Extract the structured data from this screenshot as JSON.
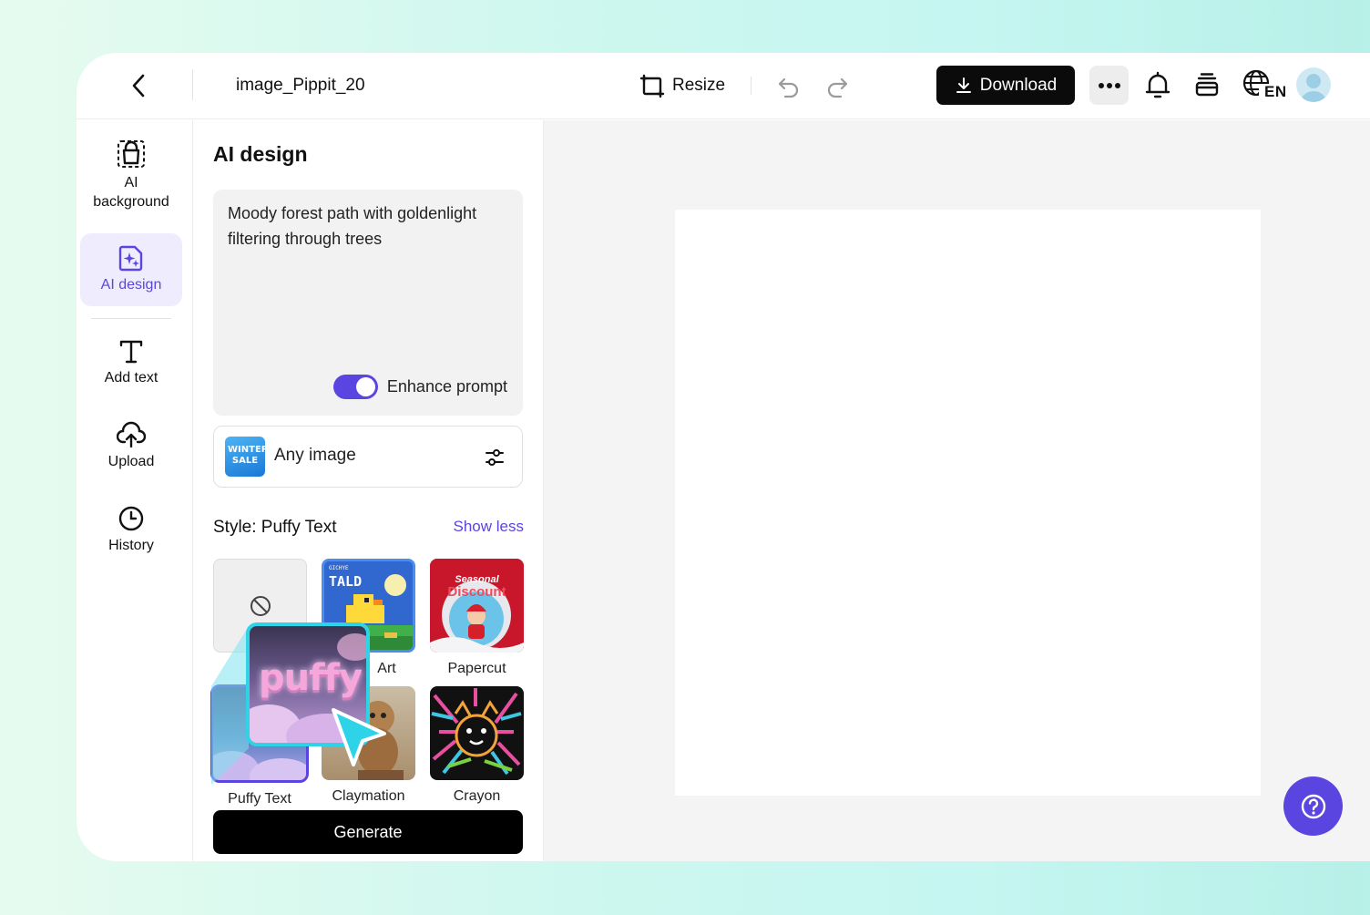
{
  "header": {
    "file_name": "image_Pippit_20",
    "resize_label": "Resize",
    "download_label": "Download",
    "language": "EN"
  },
  "nav": {
    "items": [
      {
        "label": "AI background",
        "icon": "ai-background-icon"
      },
      {
        "label": "AI design",
        "icon": "ai-design-icon",
        "active": true
      },
      {
        "label": "Add text",
        "icon": "text-icon"
      },
      {
        "label": "Upload",
        "icon": "upload-cloud-icon"
      },
      {
        "label": "History",
        "icon": "clock-icon"
      }
    ]
  },
  "panel": {
    "title": "AI design",
    "prompt": "Moody forest path with goldenlight filtering through trees",
    "enhance_label": "Enhance prompt",
    "enhance_on": true,
    "image_type": "Any image",
    "image_thumb_text": "WINTER SALE",
    "style_title": "Style: Puffy Text",
    "show_less": "Show less",
    "styles": [
      {
        "label": "",
        "kind": "none"
      },
      {
        "label": "Art",
        "kind": "pixel",
        "thumb_text": "TALD",
        "thumb_small": "GICHYE"
      },
      {
        "label": "Papercut",
        "kind": "papercut",
        "thumb_text": "Seasonal",
        "thumb_text2": "Discount"
      },
      {
        "label": "Puffy Text",
        "kind": "puffy",
        "selected": true
      },
      {
        "label": "Claymation",
        "kind": "clay"
      },
      {
        "label": "Crayon",
        "kind": "crayon"
      }
    ],
    "generate_label": "Generate",
    "zoom_text": "puffy"
  },
  "colors": {
    "accent": "#5b45e0",
    "highlight": "#2fd3e8"
  }
}
